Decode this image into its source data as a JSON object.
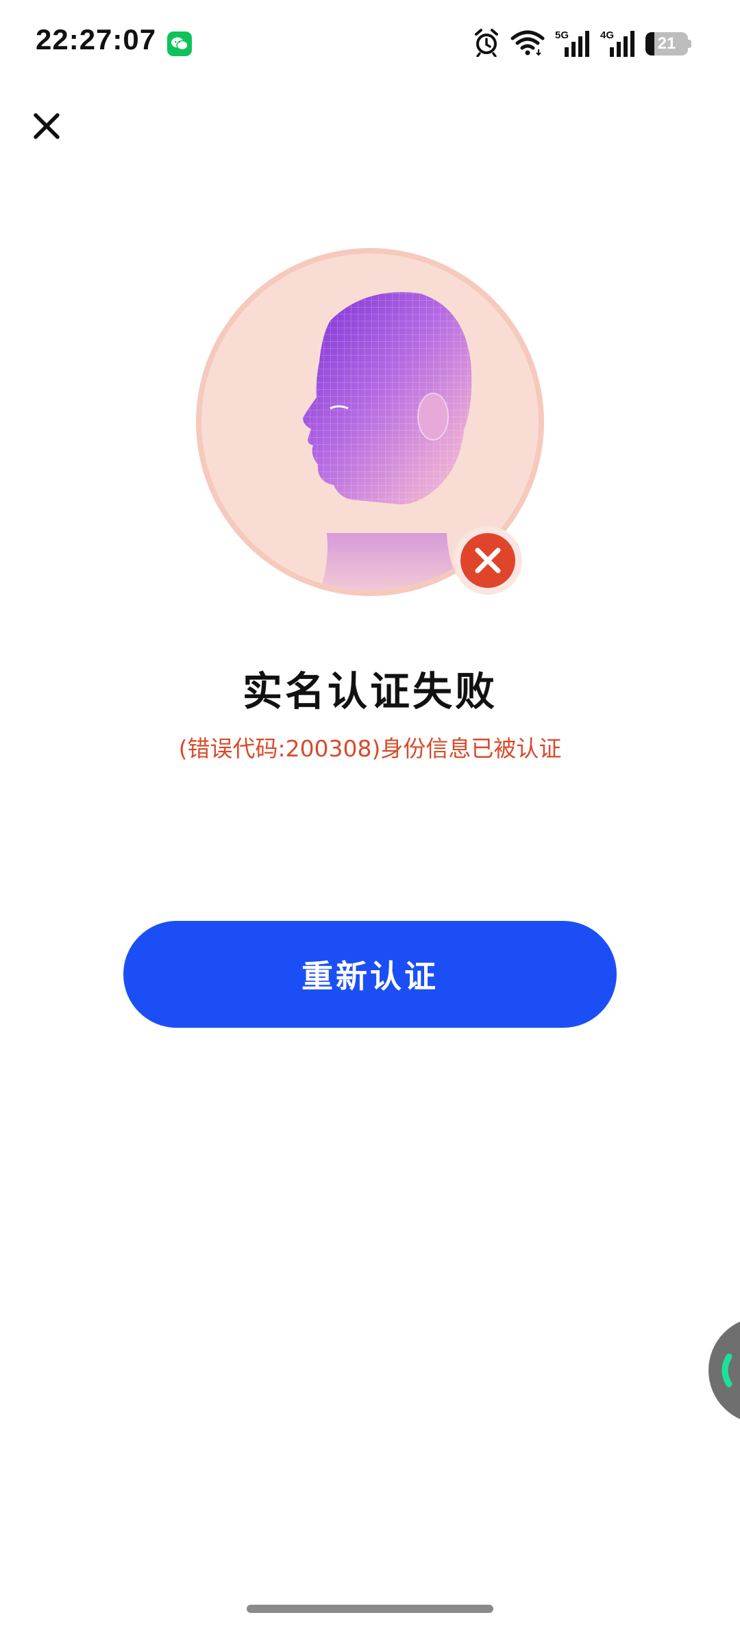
{
  "status_bar": {
    "time": "22:27:07",
    "notification_icon": "wechat-icon",
    "icons": [
      "alarm-icon",
      "wifi-icon",
      "signal-5g-icon",
      "signal-4g-icon",
      "battery-icon"
    ],
    "network_1": "5G",
    "network_2": "4G",
    "battery_level": 21,
    "battery_label": "21"
  },
  "header": {
    "close_icon": "close-icon"
  },
  "result": {
    "illustration": "face-scan-illustration",
    "status_icon": "error-x-icon",
    "title": "实名认证失败",
    "message": "(错误代码:200308)身份信息已被认证"
  },
  "actions": {
    "retry_label": "重新认证"
  },
  "colors": {
    "accent": "#1b4ff5",
    "error_text": "#d84a2a",
    "error_badge": "#e0452b",
    "circle_bg": "#f9ddd4"
  }
}
